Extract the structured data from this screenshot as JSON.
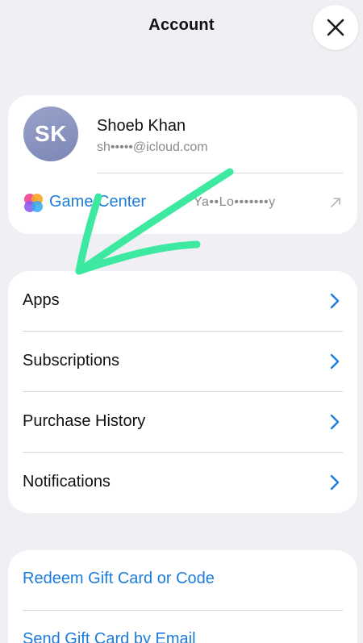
{
  "header": {
    "title": "Account"
  },
  "profile": {
    "avatar_initials": "SK",
    "name": "Shoeb Khan",
    "email": "sh•••••@icloud.com"
  },
  "game_center": {
    "label": "Game Center",
    "nickname": "Ya••Lo•••••••y"
  },
  "menu": {
    "items": [
      {
        "label": "Apps"
      },
      {
        "label": "Subscriptions"
      },
      {
        "label": "Purchase History"
      },
      {
        "label": "Notifications"
      }
    ]
  },
  "links": {
    "items": [
      {
        "label": "Redeem Gift Card or Code"
      },
      {
        "label": "Send Gift Card by Email"
      }
    ]
  },
  "colors": {
    "background": "#efeff4",
    "link_blue": "#1b7cdb",
    "annotation_arrow": "#3de8a0"
  },
  "icons": {
    "close": "close-icon",
    "chevron": "chevron-right-icon",
    "external": "arrow-up-right-icon",
    "game_center": "game-center-icon"
  }
}
